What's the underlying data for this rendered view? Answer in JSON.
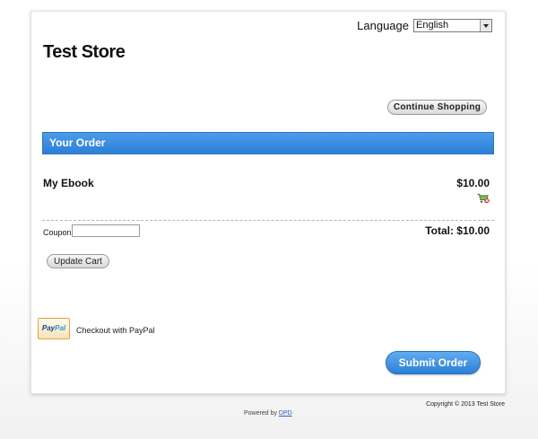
{
  "store": {
    "title": "Test Store"
  },
  "language": {
    "label": "Language",
    "selected": "English"
  },
  "buttons": {
    "continue_shopping": "Continue Shopping",
    "update_cart": "Update Cart",
    "submit_order": "Submit Order"
  },
  "order": {
    "header": "Your Order",
    "items": [
      {
        "name": "My Ebook",
        "price": "$10.00",
        "remove_icon": "cart-remove-icon"
      }
    ],
    "coupon_label": "Coupon",
    "coupon_value": "",
    "total": "Total: $10.00"
  },
  "payment": {
    "logo_pay": "Pay",
    "logo_pal": "Pal",
    "checkout_text": "Checkout with PayPal"
  },
  "footer": {
    "copyright": "Copyright © 2013 Test Store",
    "powered_prefix": "Powered by",
    "powered_link": "DPD"
  },
  "colors": {
    "accent": "#2c7fd7",
    "paypal_border": "#e0a23c"
  }
}
